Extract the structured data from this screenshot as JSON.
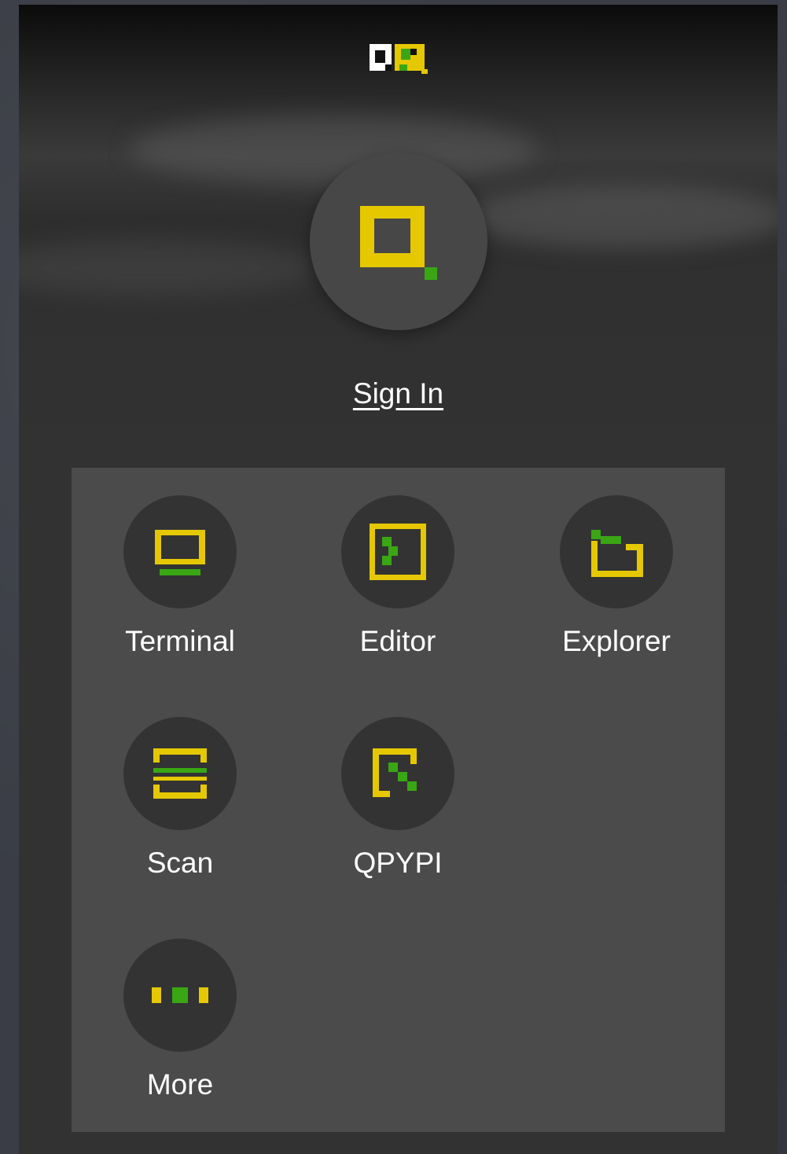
{
  "header": {
    "logo_icon": "qpython-logo-icon"
  },
  "account": {
    "avatar_icon": "qpython-avatar-icon",
    "sign_in_label": "Sign In"
  },
  "apps": [
    {
      "label": "Terminal",
      "icon": "terminal-icon"
    },
    {
      "label": "Editor",
      "icon": "editor-icon"
    },
    {
      "label": "Explorer",
      "icon": "explorer-icon"
    },
    {
      "label": "Scan",
      "icon": "scan-icon"
    },
    {
      "label": "QPYPI",
      "icon": "qpypi-icon"
    },
    {
      "label": "More",
      "icon": "more-icon"
    }
  ],
  "colors": {
    "accent_yellow": "#e5c800",
    "accent_green": "#3aa614",
    "panel": "#4b4b4b",
    "tile_circle": "#333333"
  }
}
